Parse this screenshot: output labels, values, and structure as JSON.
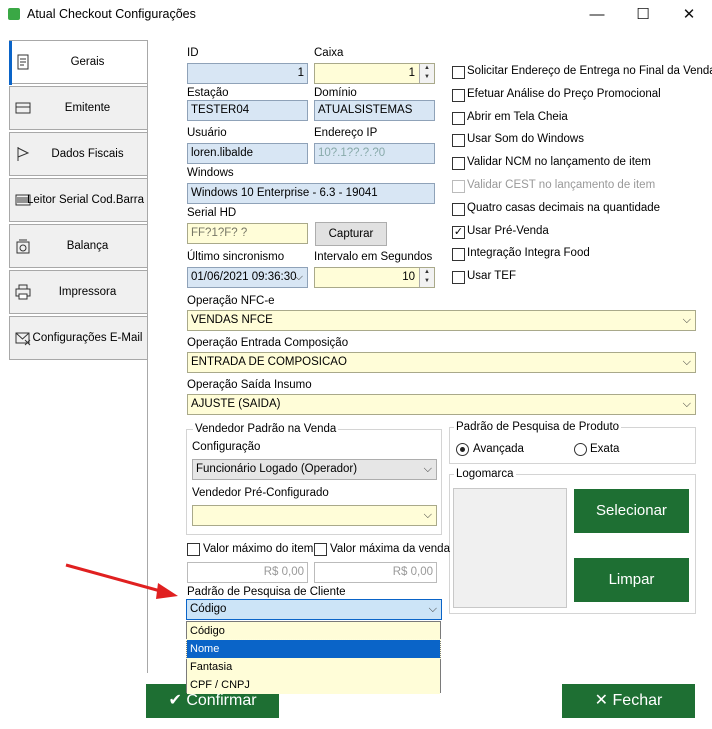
{
  "window": {
    "title": "Atual Checkout Configurações",
    "minimize": "—",
    "maximize": "☐",
    "close": "✕"
  },
  "tabs": [
    {
      "label": "Gerais",
      "icon": "document-icon"
    },
    {
      "label": "Emitente",
      "icon": "card-icon"
    },
    {
      "label": "Dados Fiscais",
      "icon": "flag-icon"
    },
    {
      "label": "Leitor Serial Cod.Barra",
      "icon": "barcode-icon"
    },
    {
      "label": "Balança",
      "icon": "scale-icon"
    },
    {
      "label": "Impressora",
      "icon": "printer-icon"
    },
    {
      "label": "Configurações E-Mail",
      "icon": "email-icon"
    }
  ],
  "fields": {
    "id": {
      "label": "ID",
      "value": "1"
    },
    "caixa": {
      "label": "Caixa",
      "value": "1"
    },
    "estacao": {
      "label": "Estação",
      "value": "TESTER04"
    },
    "dominio": {
      "label": "Domínio",
      "value": "ATUALSISTEMAS"
    },
    "usuario": {
      "label": "Usuário",
      "value": "loren.libalde"
    },
    "endereco_ip": {
      "label": "Endereço IP",
      "value": "10?.1??.?.?0"
    },
    "windows": {
      "label": "Windows",
      "value": "Windows 10 Enterprise - 6.3 - 19041"
    },
    "serial_hd": {
      "label": "Serial HD",
      "value": "FF?1?F? ?"
    },
    "capturar": "Capturar",
    "ultimo_sincronismo": {
      "label": "Último sincronismo",
      "value": "01/06/2021 09:36:30"
    },
    "intervalo": {
      "label": "Intervalo em Segundos",
      "value": "10"
    },
    "operacao_nfce": {
      "label": "Operação NFC-e",
      "value": "VENDAS NFCE"
    },
    "operacao_entrada": {
      "label": "Operação Entrada Composição",
      "value": "ENTRADA DE COMPOSICAO"
    },
    "operacao_saida": {
      "label": "Operação Saída Insumo",
      "value": "AJUSTE (SAIDA)"
    }
  },
  "checkboxes": [
    {
      "label": "Solicitar Endereço de Entrega no Final da Venda",
      "checked": false,
      "disabled": false
    },
    {
      "label": "Efetuar Análise do Preço Promocional",
      "checked": false,
      "disabled": false
    },
    {
      "label": "Abrir em Tela Cheia",
      "checked": false,
      "disabled": false
    },
    {
      "label": "Usar Som do Windows",
      "checked": false,
      "disabled": false
    },
    {
      "label": "Validar NCM no lançamento de item",
      "checked": false,
      "disabled": false
    },
    {
      "label": "Validar CEST no lançamento de item",
      "checked": false,
      "disabled": true
    },
    {
      "label": "Quatro casas decimais na quantidade",
      "checked": false,
      "disabled": false
    },
    {
      "label": "Usar Pré-Venda",
      "checked": true,
      "disabled": false
    },
    {
      "label": "Integração Integra Food",
      "checked": false,
      "disabled": false
    },
    {
      "label": "Usar TEF",
      "checked": false,
      "disabled": false
    }
  ],
  "vendedor": {
    "group_title": "Vendedor Padrão na Venda",
    "configuracao_label": "Configuração",
    "configuracao_value": "Funcionário Logado (Operador)",
    "preconfig_label": "Vendedor Pré-Configurado",
    "preconfig_value": ""
  },
  "pesquisa_produto": {
    "title": "Padrão de Pesquisa de Produto",
    "options": [
      "Avançada",
      "Exata"
    ],
    "selected": "Avançada"
  },
  "logomarca": {
    "title": "Logomarca",
    "selecionar": "Selecionar",
    "limpar": "Limpar"
  },
  "valores": {
    "max_item_label": "Valor máximo do item",
    "max_item_value": "R$ 0,00",
    "max_venda_label": "Valor máxima da venda",
    "max_venda_value": "R$ 0,00"
  },
  "pesquisa_cliente": {
    "label": "Padrão de Pesquisa de Cliente",
    "value": "Código",
    "options": [
      "Código",
      "Nome",
      "Fantasia",
      "CPF / CNPJ"
    ],
    "highlighted": "Nome"
  },
  "footer": {
    "confirmar": "Confirmar",
    "fechar": "Fechar"
  },
  "colors": {
    "accent": "#0a64c8",
    "green_button": "#1e6f33",
    "field_blue": "#d8e6f4",
    "field_yellow": "#fffdd8",
    "arrow_red": "#e02020"
  }
}
